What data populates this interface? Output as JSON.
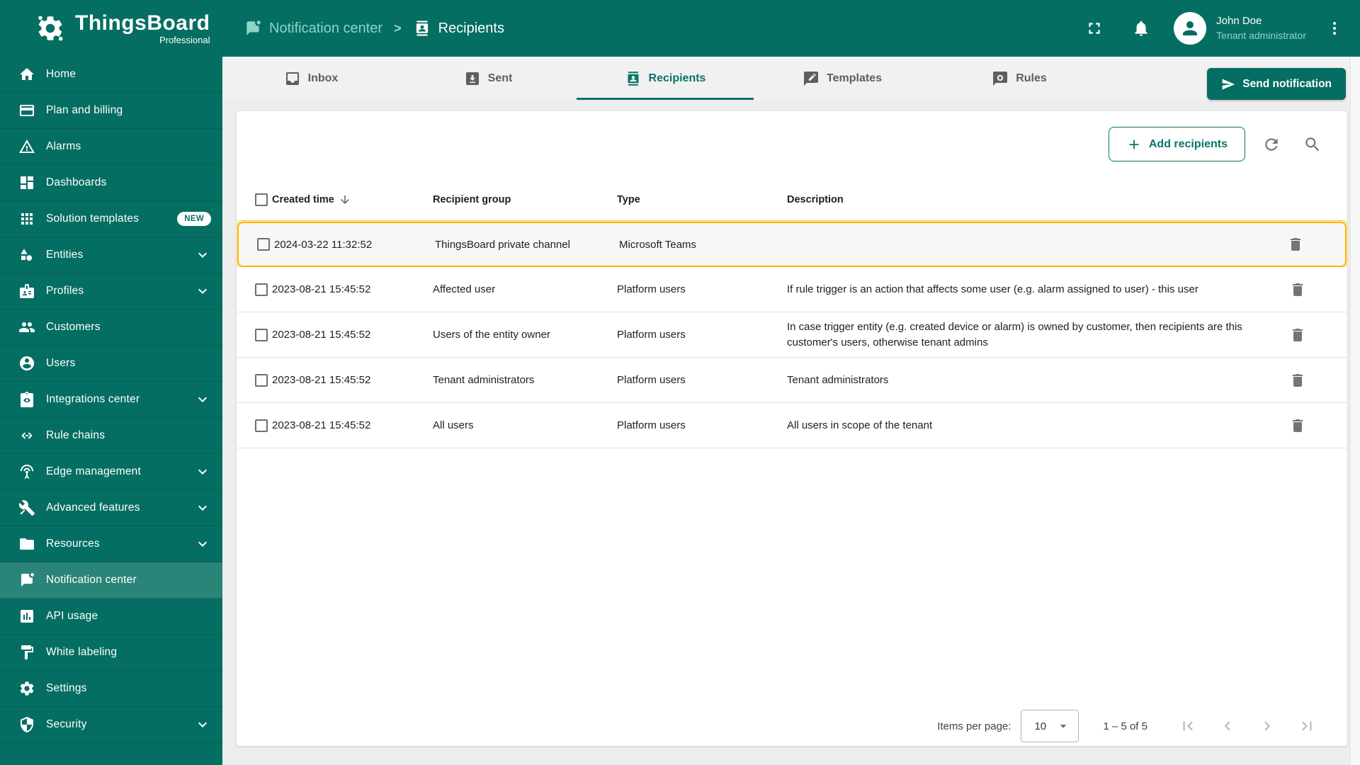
{
  "colors": {
    "primary": "#056e62",
    "primary_active": "#2b8478",
    "accent": "#077568",
    "accent_light": "#8bd5c9",
    "highlight": "#ffb300",
    "content_bg": "#ededed",
    "tabbar_bg": "#f1f1f1",
    "card_bg": "#ffffff",
    "text": "#212121",
    "text_secondary": "#5f6368",
    "icon_gray": "#757575",
    "disabled": "#b9b9b9",
    "divider": "#e0e0e0"
  },
  "logo": {
    "title": "ThingsBoard",
    "subtitle": "Professional"
  },
  "header": {
    "breadcrumb": {
      "parent": "Notification center",
      "separator": ">",
      "current": "Recipients"
    },
    "user": {
      "name": "John Doe",
      "role": "Tenant administrator"
    }
  },
  "sidebar": {
    "items": [
      {
        "label": "Home",
        "icon": "home"
      },
      {
        "label": "Plan and billing",
        "icon": "billing"
      },
      {
        "label": "Alarms",
        "icon": "alarms"
      },
      {
        "label": "Dashboards",
        "icon": "dashboards"
      },
      {
        "label": "Solution templates",
        "icon": "apps",
        "badge": "NEW"
      },
      {
        "label": "Entities",
        "icon": "entities",
        "expandable": true
      },
      {
        "label": "Profiles",
        "icon": "profiles",
        "expandable": true
      },
      {
        "label": "Customers",
        "icon": "customers"
      },
      {
        "label": "Users",
        "icon": "users"
      },
      {
        "label": "Integrations center",
        "icon": "integrations",
        "expandable": true
      },
      {
        "label": "Rule chains",
        "icon": "rulechains"
      },
      {
        "label": "Edge management",
        "icon": "edge",
        "expandable": true
      },
      {
        "label": "Advanced features",
        "icon": "advanced",
        "expandable": true
      },
      {
        "label": "Resources",
        "icon": "resources",
        "expandable": true
      },
      {
        "label": "Notification center",
        "icon": "notification",
        "active": true
      },
      {
        "label": "API usage",
        "icon": "api"
      },
      {
        "label": "White labeling",
        "icon": "whitelabel"
      },
      {
        "label": "Settings",
        "icon": "settings"
      },
      {
        "label": "Security",
        "icon": "security",
        "expandable": true
      }
    ]
  },
  "tabs": [
    {
      "label": "Inbox",
      "icon": "inbox"
    },
    {
      "label": "Sent",
      "icon": "sent"
    },
    {
      "label": "Recipients",
      "icon": "recipients",
      "active": true
    },
    {
      "label": "Templates",
      "icon": "templates"
    },
    {
      "label": "Rules",
      "icon": "rules"
    }
  ],
  "tabs_bar": {
    "send_label": "Send notification"
  },
  "toolbar": {
    "add_label": "Add recipients"
  },
  "table": {
    "columns": [
      "Created time",
      "Recipient group",
      "Type",
      "Description"
    ],
    "sort_column": "Created time",
    "rows": [
      {
        "created": "2024-03-22 11:32:52",
        "group": "ThingsBoard private channel",
        "type": "Microsoft Teams",
        "description": "",
        "highlighted": true
      },
      {
        "created": "2023-08-21 15:45:52",
        "group": "Affected user",
        "type": "Platform users",
        "description": "If rule trigger is an action that affects some user (e.g. alarm assigned to user) - this user"
      },
      {
        "created": "2023-08-21 15:45:52",
        "group": "Users of the entity owner",
        "type": "Platform users",
        "description": "In case trigger entity (e.g. created device or alarm) is owned by customer, then recipients are this customer's users, otherwise tenant admins"
      },
      {
        "created": "2023-08-21 15:45:52",
        "group": "Tenant administrators",
        "type": "Platform users",
        "description": "Tenant administrators"
      },
      {
        "created": "2023-08-21 15:45:52",
        "group": "All users",
        "type": "Platform users",
        "description": "All users in scope of the tenant"
      }
    ]
  },
  "pagination": {
    "items_per_page_label": "Items per page:",
    "page_size": "10",
    "range": "1 – 5 of 5"
  }
}
